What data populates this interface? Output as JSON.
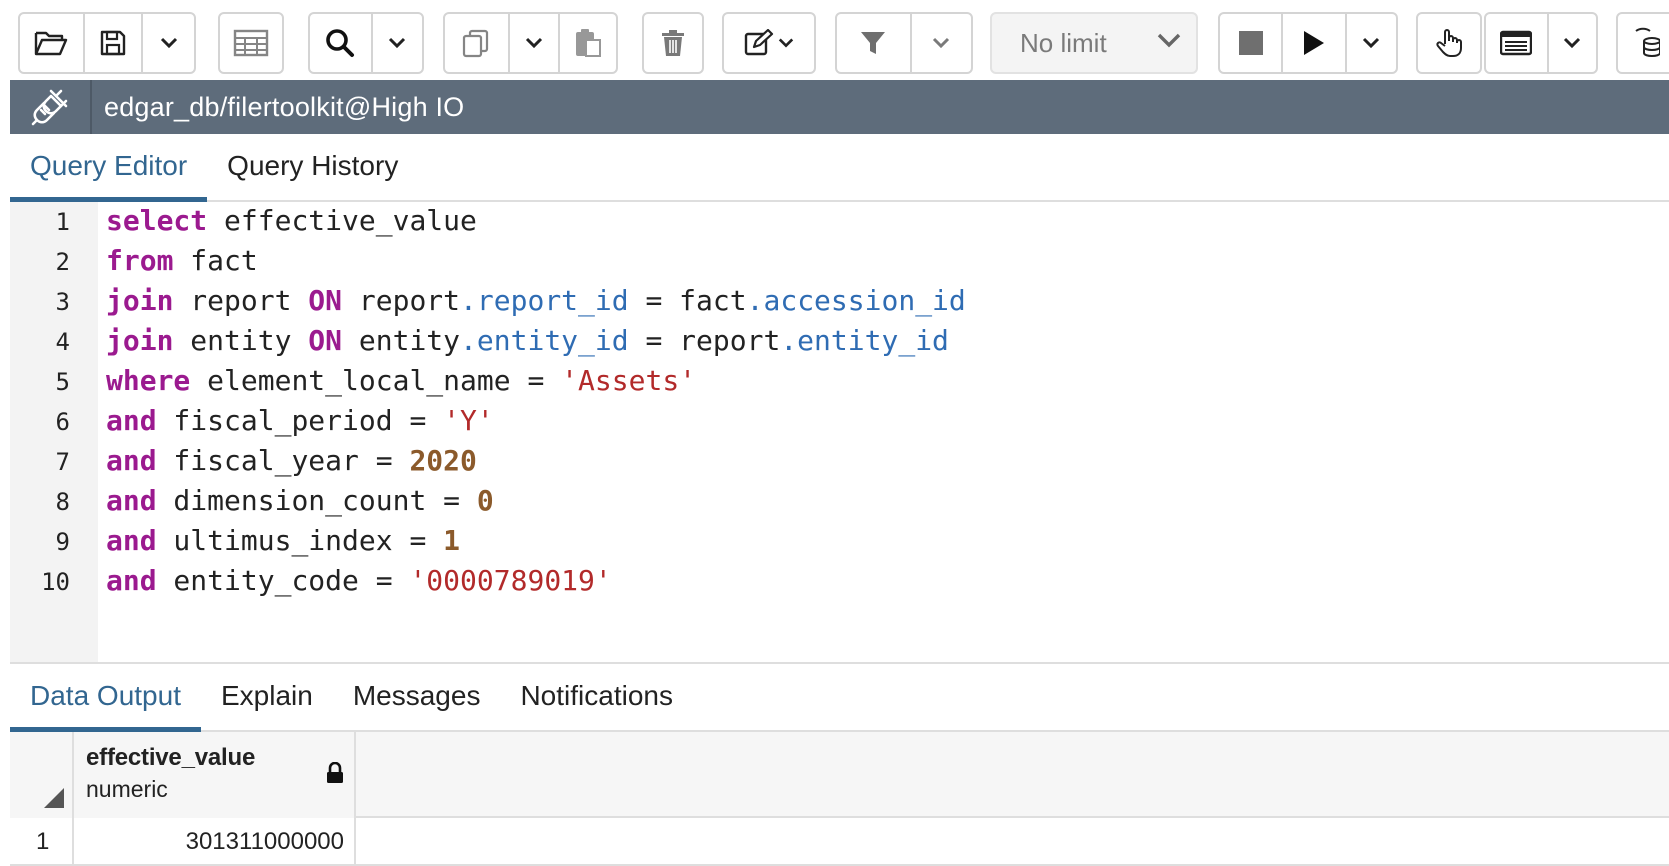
{
  "toolbar": {
    "icons": [
      "folder-open-icon",
      "save-icon",
      "chevron-down-icon",
      "table-icon",
      "search-icon",
      "chevron-down-icon",
      "copy-icon",
      "chevron-down-icon",
      "paste-icon",
      "trash-icon",
      "edit-icon",
      "chevron-down-icon",
      "filter-icon",
      "chevron-down-icon",
      "stop-icon",
      "play-icon",
      "chevron-down-icon",
      "hand-pointer-icon",
      "list-icon",
      "chevron-down-icon",
      "database-refresh-icon"
    ],
    "limit_value": "No limit"
  },
  "connection": {
    "label": "edgar_db/filertoolkit@High IO"
  },
  "editor_tabs": [
    {
      "label": "Query Editor",
      "active": true
    },
    {
      "label": "Query History",
      "active": false
    }
  ],
  "editor": {
    "line_numbers": [
      "1",
      "2",
      "3",
      "4",
      "5",
      "6",
      "7",
      "8",
      "9",
      "10"
    ],
    "lines": [
      {
        "t1": "select",
        "t2": " effective_value"
      },
      {
        "t1": "from",
        "t2": " fact"
      },
      {
        "t1": "join",
        "t2": " report ",
        "t3": "ON",
        "t4": " report",
        "t5": ".report_id",
        "t6": " = fact",
        "t7": ".accession_id"
      },
      {
        "t1": "join",
        "t2": " entity ",
        "t3": "ON",
        "t4": " entity",
        "t5": ".entity_id",
        "t6": " = report",
        "t7": ".entity_id"
      },
      {
        "t1": "where",
        "t2": " element_local_name = ",
        "t3": "'Assets'"
      },
      {
        "t1": "and",
        "t2": " fiscal_period = ",
        "t3": "'Y'"
      },
      {
        "t1": "and",
        "t2": " fiscal_year = ",
        "t3": "2020"
      },
      {
        "t1": "and",
        "t2": " dimension_count = ",
        "t3": "0"
      },
      {
        "t1": "and",
        "t2": " ultimus_index = ",
        "t3": "1"
      },
      {
        "t1": "and",
        "t2": " entity_code = ",
        "t3": "'0000789019'"
      }
    ]
  },
  "output_tabs": [
    {
      "label": "Data Output",
      "active": true
    },
    {
      "label": "Explain",
      "active": false
    },
    {
      "label": "Messages",
      "active": false
    },
    {
      "label": "Notifications",
      "active": false
    }
  ],
  "results": {
    "columns": [
      {
        "name": "effective_value",
        "type": "numeric"
      }
    ],
    "rows": [
      {
        "num": "1",
        "values": [
          "301311000000"
        ]
      }
    ]
  },
  "colors": {
    "accent": "#326690",
    "connbar": "#5e6c7b",
    "keyword": "#9b1a8f",
    "property": "#2f6cb3",
    "string": "#b22a2a",
    "number": "#8b5a2b"
  }
}
